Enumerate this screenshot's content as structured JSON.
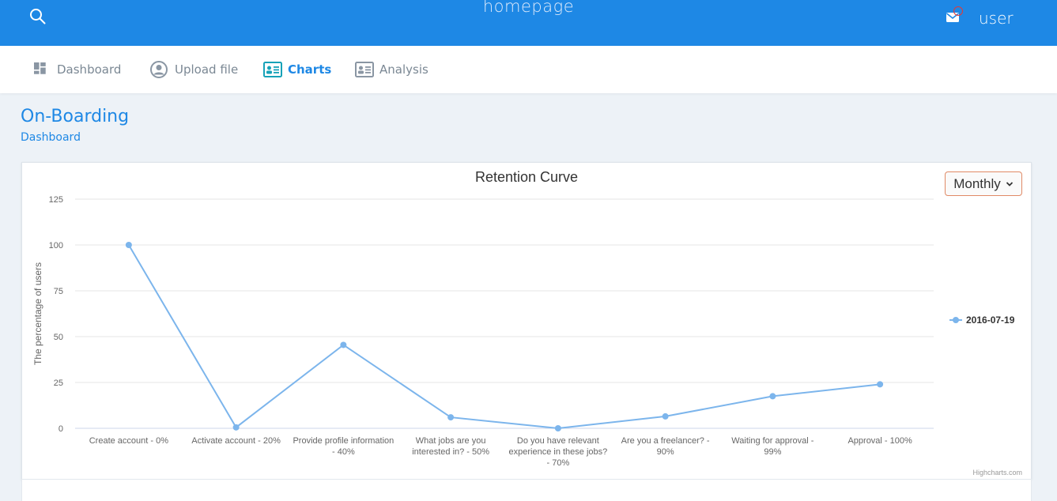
{
  "header": {
    "title": "homepage",
    "user": "user",
    "search_icon": "search-icon",
    "mail_icon": "mail-icon",
    "bar_color": "#1e88e5"
  },
  "nav": {
    "items": [
      {
        "label": "Dashboard",
        "icon": "dashboard-icon",
        "active": false
      },
      {
        "label": "Upload file",
        "icon": "user-circle-icon",
        "active": false
      },
      {
        "label": "Charts",
        "icon": "id-card-icon",
        "active": true
      },
      {
        "label": "Analysis",
        "icon": "id-card-icon",
        "active": false
      }
    ]
  },
  "page": {
    "title": "On-Boarding",
    "breadcrumb": "Dashboard"
  },
  "period_select": {
    "selected": "Monthly"
  },
  "chart_data": {
    "type": "line",
    "title": "Retention Curve",
    "ylabel": "The percentage of users",
    "xlabel": "",
    "ylim": [
      0,
      125
    ],
    "yticks": [
      0,
      25,
      50,
      75,
      100,
      125
    ],
    "grid": true,
    "legend_position": "right",
    "categories": [
      "Create account - 0%",
      "Activate account - 20%",
      "Provide profile information - 40%",
      "What jobs are you interested in? - 50%",
      "Do you have relevant experience in these jobs? - 70%",
      "Are you a freelancer? - 90%",
      "Waiting for approval - 99%",
      "Approval - 100%"
    ],
    "category_lines": [
      [
        "Create account - 0%"
      ],
      [
        "Activate account - 20%"
      ],
      [
        "Provide profile information",
        "- 40%"
      ],
      [
        "What jobs are you",
        "interested in? - 50%"
      ],
      [
        "Do you have relevant",
        "experience in these jobs?",
        "- 70%"
      ],
      [
        "Are you a freelancer? -",
        "90%"
      ],
      [
        "Waiting for approval -",
        "99%"
      ],
      [
        "Approval - 100%"
      ]
    ],
    "series": [
      {
        "name": "2016-07-19",
        "color": "#7cb5ec",
        "values": [
          100,
          0.5,
          45.5,
          6,
          0,
          6.5,
          17.5,
          24
        ]
      }
    ],
    "credits": "Highcharts.com"
  }
}
